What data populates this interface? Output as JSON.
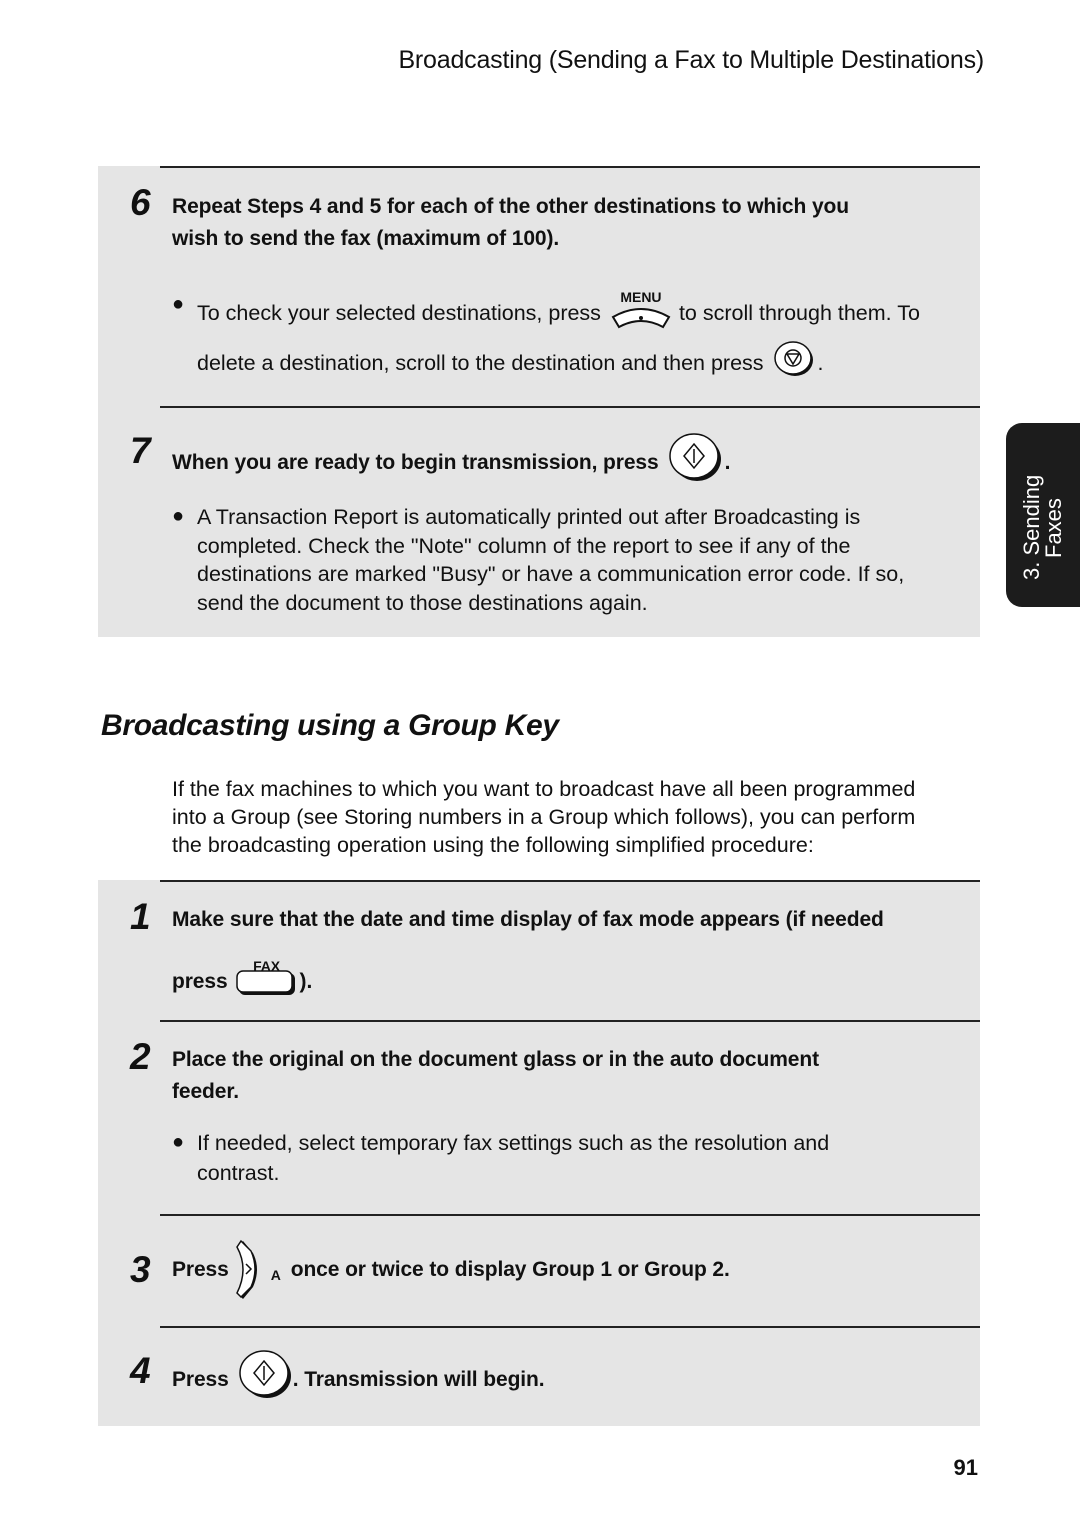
{
  "header": {
    "running_title": "Broadcasting (Sending a Fax to Multiple Destinations)"
  },
  "side_tab": {
    "line1": "3. Sending",
    "line2": "Faxes"
  },
  "panel_top": {
    "steps": [
      {
        "number": "6",
        "text_line1": "Repeat Steps 4 and 5 for each of the other destinations to which you",
        "text_line2": "wish to send the fax (maximum of 100).",
        "bullet": {
          "part1": "To check your selected destinations, press",
          "key1_label": "MENU",
          "key1_icon": "menu-key-icon",
          "part2": "to scroll through them. To",
          "part3": "delete a destination, scroll to the destination and then press",
          "key2_icon": "stop-key-icon",
          "part4": "."
        }
      },
      {
        "number": "7",
        "text": "When you are ready to begin transmission, press",
        "key_icon": "start-key-icon",
        "text_end": ".",
        "bullet_lines": [
          "A Transaction Report is automatically printed out after Broadcasting is",
          "completed. Check the \"Note\" column of the report to see if any of the",
          "destinations are marked \"Busy\" or have a communication error code. If so,",
          "send the document to those destinations again."
        ]
      }
    ]
  },
  "section": {
    "title": "Broadcasting using a Group Key",
    "intro_lines": [
      "If the fax machines to which you want to broadcast have all been programmed",
      "into a Group (see Storing numbers in a Group which follows), you can perform",
      "the broadcasting operation using the following simplified procedure:"
    ]
  },
  "panel_bottom": {
    "steps": [
      {
        "number": "1",
        "text_line1": "Make sure that the date and time display of fax mode appears (if needed",
        "text_line2_before": "press",
        "key_label": "FAX",
        "key_icon": "fax-key-icon",
        "text_line2_after": ")."
      },
      {
        "number": "2",
        "text_line1": "Place the original on the document glass or in the auto document",
        "text_line2": "feeder.",
        "bullet_lines": [
          "If needed, select temporary fax settings such as the resolution and",
          "contrast."
        ]
      },
      {
        "number": "3",
        "text_before": "Press",
        "key_icon": "right-arrow-key-icon",
        "key_label": "A",
        "text_after": "once or twice to display Group 1 or Group 2."
      },
      {
        "number": "4",
        "text_before": "Press",
        "key_icon": "start-key-icon",
        "text_after": ". Transmission will begin."
      }
    ]
  },
  "footer": {
    "page_number": "91"
  }
}
